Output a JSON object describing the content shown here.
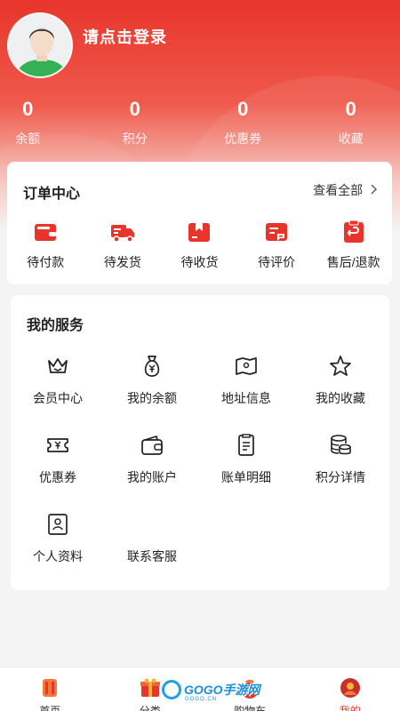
{
  "profile": {
    "login_prompt": "请点击登录"
  },
  "stats": [
    {
      "value": "0",
      "label": "余额"
    },
    {
      "value": "0",
      "label": "积分"
    },
    {
      "value": "0",
      "label": "优惠券"
    },
    {
      "value": "0",
      "label": "收藏"
    }
  ],
  "orders": {
    "title": "订单中心",
    "view_all": "查看全部",
    "items": [
      {
        "label": "待付款",
        "icon": "wallet-icon"
      },
      {
        "label": "待发货",
        "icon": "truck-icon"
      },
      {
        "label": "待收货",
        "icon": "package-icon"
      },
      {
        "label": "待评价",
        "icon": "review-icon"
      },
      {
        "label": "售后/退款",
        "icon": "refund-icon"
      }
    ]
  },
  "services": {
    "title": "我的服务",
    "items": [
      {
        "label": "会员中心",
        "icon": "crown-icon"
      },
      {
        "label": "我的余额",
        "icon": "money-bag-icon"
      },
      {
        "label": "地址信息",
        "icon": "map-icon"
      },
      {
        "label": "我的收藏",
        "icon": "star-icon"
      },
      {
        "label": "优惠券",
        "icon": "coupon-icon"
      },
      {
        "label": "我的账户",
        "icon": "wallet-outline-icon"
      },
      {
        "label": "账单明细",
        "icon": "bill-icon"
      },
      {
        "label": "积分详情",
        "icon": "coins-icon"
      },
      {
        "label": "个人资料",
        "icon": "profile-card-icon"
      },
      {
        "label": "联系客服",
        "icon": "headset-icon"
      }
    ]
  },
  "tabbar": [
    {
      "label": "首页",
      "icon": "home-tab-icon",
      "active": false
    },
    {
      "label": "分类",
      "icon": "category-tab-icon",
      "active": false
    },
    {
      "label": "购物车",
      "icon": "cart-tab-icon",
      "active": false
    },
    {
      "label": "我的",
      "icon": "mine-tab-icon",
      "active": true
    }
  ],
  "watermark": {
    "text": "GOGO手游网",
    "sub": "GOGO.CN"
  },
  "colors": {
    "accent": "#e8352b",
    "background": "#f4f4f4"
  }
}
